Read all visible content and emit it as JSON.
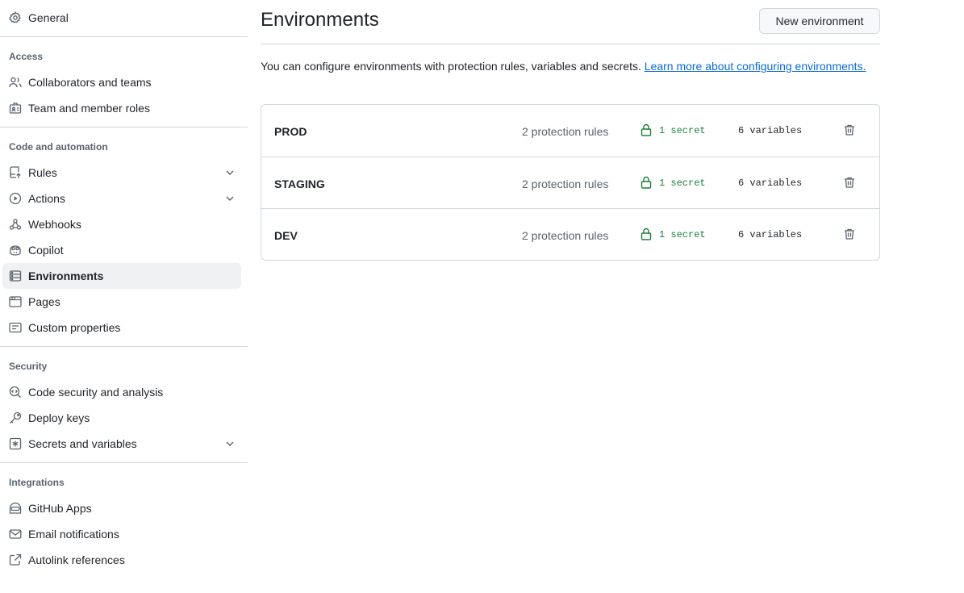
{
  "sidebar": {
    "items": [
      {
        "label": "General",
        "icon": "gear-icon"
      },
      {
        "label": "Collaborators and teams",
        "icon": "people-icon"
      },
      {
        "label": "Team and member roles",
        "icon": "id-badge-icon"
      },
      {
        "label": "Rules",
        "icon": "repo-push-icon"
      },
      {
        "label": "Actions",
        "icon": "play-icon"
      },
      {
        "label": "Webhooks",
        "icon": "webhook-icon"
      },
      {
        "label": "Copilot",
        "icon": "copilot-icon"
      },
      {
        "label": "Environments",
        "icon": "server-icon",
        "active": true
      },
      {
        "label": "Pages",
        "icon": "browser-icon"
      },
      {
        "label": "Custom properties",
        "icon": "note-icon"
      },
      {
        "label": "Code security and analysis",
        "icon": "codescan-icon"
      },
      {
        "label": "Deploy keys",
        "icon": "key-icon"
      },
      {
        "label": "Secrets and variables",
        "icon": "asterisk-icon"
      },
      {
        "label": "GitHub Apps",
        "icon": "hubot-icon"
      },
      {
        "label": "Email notifications",
        "icon": "mail-icon"
      },
      {
        "label": "Autolink references",
        "icon": "cross-reference-icon"
      }
    ],
    "sections": {
      "access": "Access",
      "code_automation": "Code and automation",
      "security": "Security",
      "integrations": "Integrations"
    }
  },
  "main": {
    "title": "Environments",
    "new_button": "New environment",
    "intro_text": "You can configure environments with protection rules, variables and secrets. ",
    "intro_link": "Learn more about configuring environments.",
    "environments": [
      {
        "name": "PROD",
        "rules": "2 protection rules",
        "secrets": "1 secret",
        "variables": "6 variables"
      },
      {
        "name": "STAGING",
        "rules": "2 protection rules",
        "secrets": "1 secret",
        "variables": "6 variables"
      },
      {
        "name": "DEV",
        "rules": "2 protection rules",
        "secrets": "1 secret",
        "variables": "6 variables"
      }
    ]
  },
  "colors": {
    "accent_link": "#0969da",
    "secret_green": "#1a7f37",
    "muted_text": "#59636e",
    "border": "#d1d9e0",
    "active_bg": "#f0f1f3"
  }
}
